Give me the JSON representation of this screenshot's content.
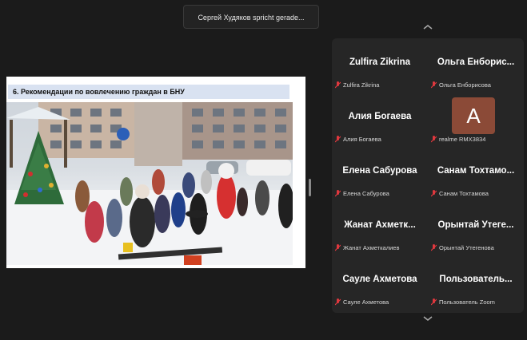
{
  "speaker_banner": "Сергей Худяков spricht gerade...",
  "slide": {
    "title": "6. Рекомендации по вовлечению граждан в БНУ"
  },
  "participants": [
    {
      "name": "Zulfira Zikrina",
      "label": "Zulfira Zikrina"
    },
    {
      "name": "Ольга Енборис...",
      "label": "Ольга Енборисова"
    },
    {
      "name": "Алия Богаева",
      "label": "Алия Богаева"
    },
    {
      "name": "",
      "label": "realme RMX3834",
      "avatar": "A"
    },
    {
      "name": "Елена Сабурова",
      "label": "Елена Сабурова"
    },
    {
      "name": "Санам Тохтамо...",
      "label": "Санам Тохтамова"
    },
    {
      "name": "Жанат Ахметк...",
      "label": "Жанат Ахметкалиев"
    },
    {
      "name": "Орынтай Утеге...",
      "label": "Орынтай Утегенова"
    },
    {
      "name": "Сауле Ахметова",
      "label": "Сауле Ахметова"
    },
    {
      "name": "Пользователь...",
      "label": "Пользователь Zoom"
    }
  ],
  "icons": {
    "mic_muted": "mic-muted-icon",
    "scroll_up": "chevron-up-icon",
    "scroll_down": "chevron-down-icon"
  },
  "colors": {
    "background": "#1b1b1b",
    "panel": "#262626",
    "mic_muted": "#e0383e",
    "avatar": "#8b4a37"
  }
}
